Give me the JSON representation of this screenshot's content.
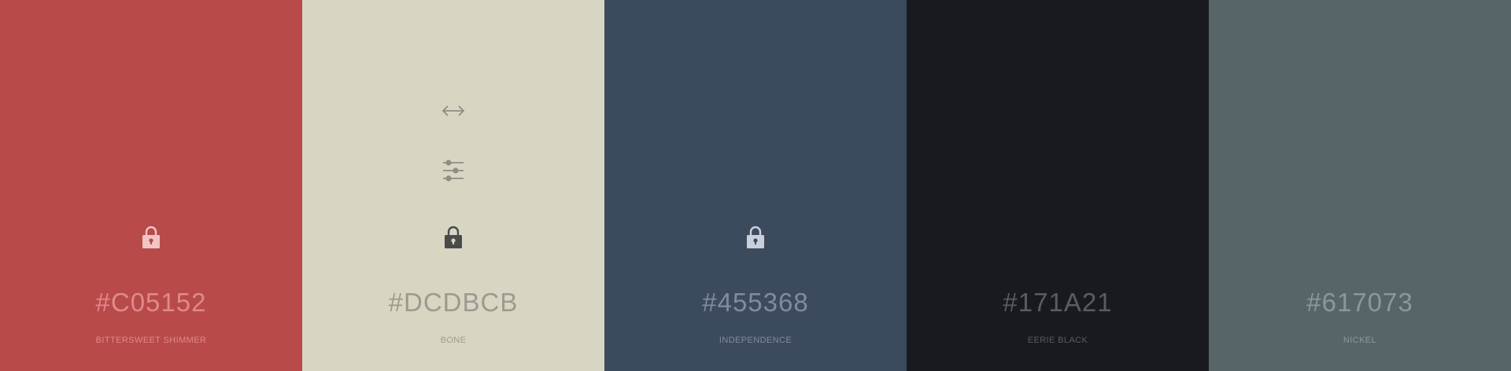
{
  "swatches": [
    {
      "hex": "#C05152",
      "name": "BITTERSWEET SHIMMER",
      "bg": "#B84A4A",
      "text_color": "#E08A8A",
      "lock_color": "#F2C4C4",
      "tools": [
        "lock-icon"
      ]
    },
    {
      "hex": "#DCDBCB",
      "name": "BONE",
      "bg": "#D8D6C3",
      "text_color": "#9C9A90",
      "lock_color": "#4A4A4A",
      "icon_color": "#8E8D85",
      "tools": [
        "resize-horizontal-icon",
        "adjust-sliders-icon",
        "lock-icon"
      ]
    },
    {
      "hex": "#455368",
      "name": "INDEPENDENCE",
      "bg": "#3C4A5E",
      "text_color": "#7F8BA0",
      "lock_color": "#C9D0DC",
      "tools": [
        "lock-icon"
      ]
    },
    {
      "hex": "#171A21",
      "name": "EERIE BLACK",
      "bg": "#191A1F",
      "text_color": "#5A5C63",
      "tools": []
    },
    {
      "hex": "#617073",
      "name": "NICKEL",
      "bg": "#586568",
      "text_color": "#8C9799",
      "tools": []
    }
  ]
}
